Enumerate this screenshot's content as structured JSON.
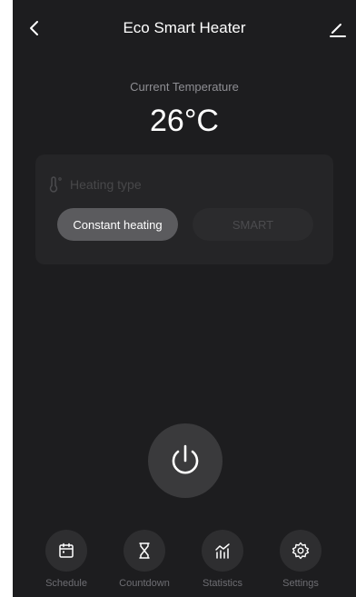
{
  "header": {
    "title": "Eco Smart Heater"
  },
  "temperature": {
    "label": "Current Temperature",
    "value": "26°C"
  },
  "heating_card": {
    "title": "Heating type",
    "options": [
      "Constant heating",
      "SMART"
    ],
    "selected": "Constant heating"
  },
  "bottom_nav": {
    "items": [
      {
        "label": "Schedule",
        "icon": "calendar-icon"
      },
      {
        "label": "Countdown",
        "icon": "hourglass-icon"
      },
      {
        "label": "Statistics",
        "icon": "chart-icon"
      },
      {
        "label": "Settings",
        "icon": "gear-icon"
      }
    ]
  },
  "colors": {
    "background": "#1d1d1f",
    "card": "#252527",
    "active_button": "#5b5b5e",
    "text_primary": "#ffffff",
    "text_secondary": "#8e8e93"
  }
}
